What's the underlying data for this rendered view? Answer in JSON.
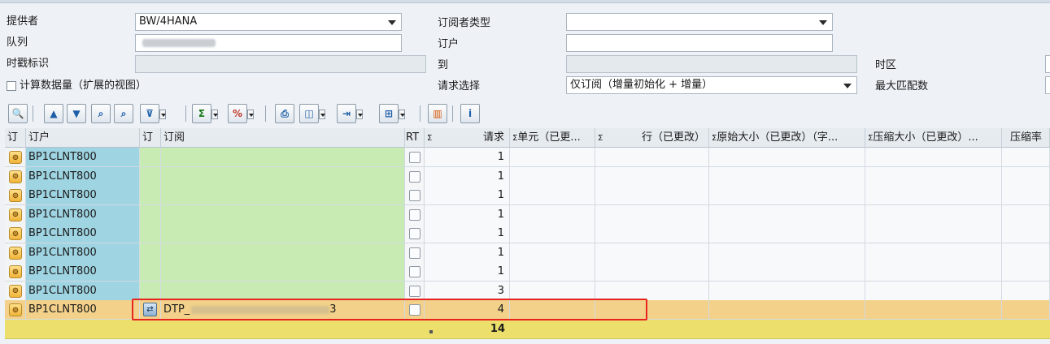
{
  "form": {
    "provider_label": "提供者",
    "provider_value": "BW/4HANA",
    "queue_label": "队列",
    "timestamp_label": "时戳标识",
    "calc_label": "计算数据量（扩展的视图）",
    "subscriber_type_label": "订阅者类型",
    "subscriber_label": "订户",
    "to_label": "到",
    "request_select_label": "请求选择",
    "request_select_value": "仅订阅（增量初始化 + 增量）",
    "timezone_label": "时区",
    "max_hits_label": "最大匹配数"
  },
  "toolbar": {
    "buttons": [
      "details-icon",
      "sort-asc-icon",
      "sort-desc-icon",
      "find-icon",
      "find-next-icon",
      "filter-icon",
      "sum-icon",
      "subtotal-icon",
      "print-icon",
      "view-icon",
      "export-icon",
      "layout-icon",
      "graphic-icon",
      "info-icon"
    ]
  },
  "grid": {
    "headers": {
      "col_icon": "订",
      "col_customer": "订户",
      "col_sflag": "订",
      "col_subscription": "订阅",
      "col_rt": "RT",
      "col_requests": "请求",
      "col_units": "单元（已更...",
      "col_lines": "行（已更改）",
      "col_orig": "原始大小（已更改）（字...",
      "col_comp": "压缩大小（已更改）...",
      "col_ratio": "压缩率"
    },
    "sigma": "Σ",
    "rows": [
      {
        "customer": "BP1CLNT800",
        "subscription": "",
        "requests": "1"
      },
      {
        "customer": "BP1CLNT800",
        "subscription": "",
        "requests": "1"
      },
      {
        "customer": "BP1CLNT800",
        "subscription": "",
        "requests": "1"
      },
      {
        "customer": "BP1CLNT800",
        "subscription": "",
        "requests": "1"
      },
      {
        "customer": "BP1CLNT800",
        "subscription": "",
        "requests": "1"
      },
      {
        "customer": "BP1CLNT800",
        "subscription": "",
        "requests": "1"
      },
      {
        "customer": "BP1CLNT800",
        "subscription": "",
        "requests": "1"
      },
      {
        "customer": "BP1CLNT800",
        "subscription": "",
        "requests": "3"
      },
      {
        "customer": "BP1CLNT800",
        "subscription": "DTP_",
        "subscription_end": "3",
        "requests": "4",
        "highlighted": true
      }
    ],
    "total_requests": "14"
  },
  "colors": {
    "customer_bg": "#9fd4e2",
    "subscription_bg": "#c8ebb4",
    "highlight_bg": "#f3d18a",
    "total_bg": "#ecdf6c",
    "redbox": "#e5251e"
  }
}
